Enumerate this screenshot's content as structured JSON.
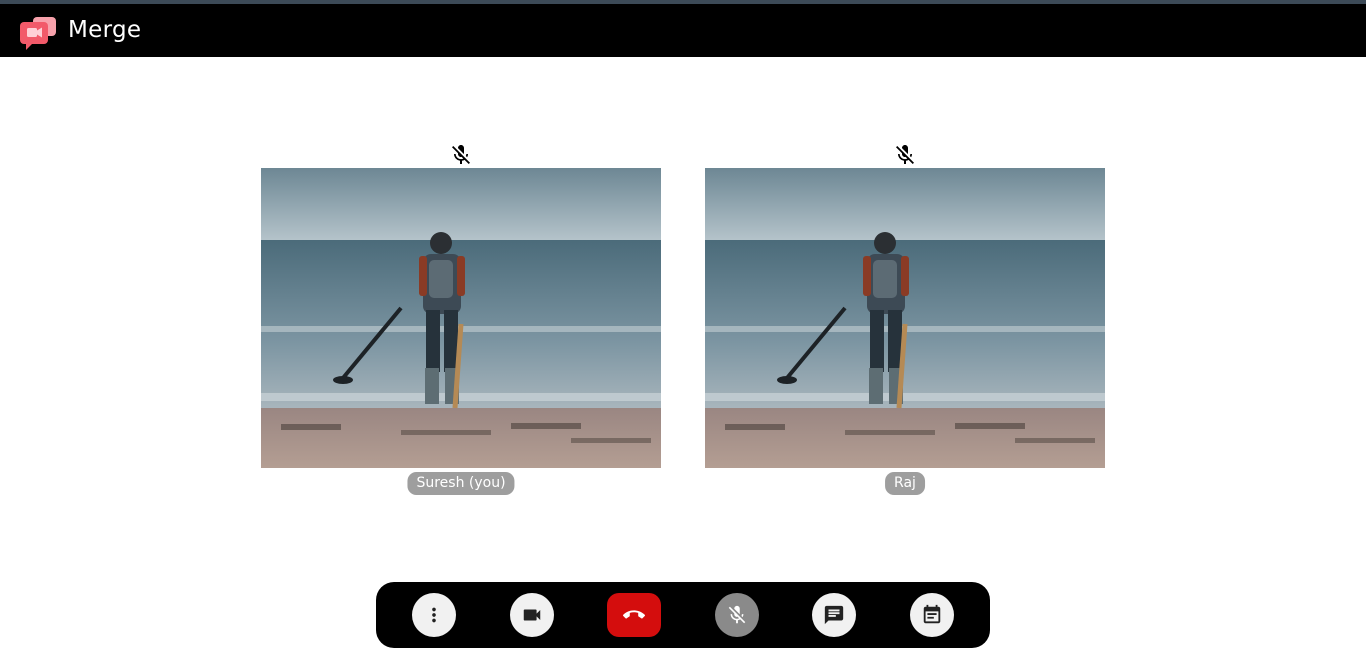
{
  "app": {
    "name": "Merge",
    "brand_color": "#f25a6a"
  },
  "participants": [
    {
      "name": "Suresh (you)",
      "mic_muted": true,
      "mic_icon": "mic-off-icon"
    },
    {
      "name": "Raj",
      "mic_muted": true,
      "mic_icon": "mic-off-icon"
    }
  ],
  "controls": [
    {
      "name": "more-options",
      "icon": "more-vert-icon"
    },
    {
      "name": "camera",
      "icon": "videocam-icon"
    },
    {
      "name": "end-call",
      "icon": "call-end-icon",
      "color": "#d40d0d"
    },
    {
      "name": "microphone",
      "icon": "mic-off-icon",
      "state": "muted"
    },
    {
      "name": "chat",
      "icon": "chat-icon"
    },
    {
      "name": "schedule",
      "icon": "event-note-icon"
    }
  ]
}
